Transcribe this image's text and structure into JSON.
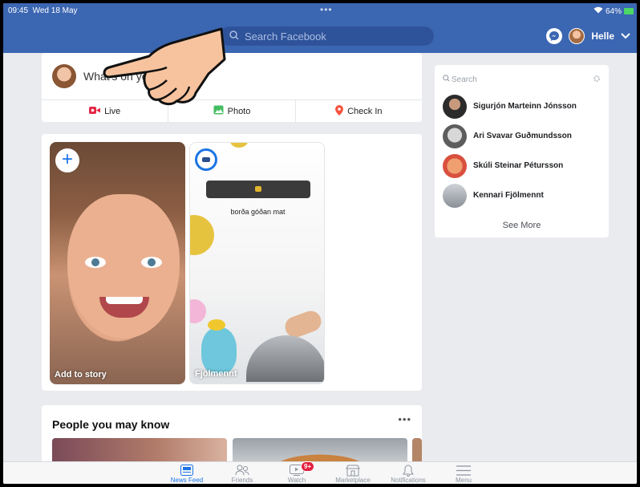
{
  "status": {
    "time": "09:45",
    "date": "Wed 18 May",
    "battery_percent": "64%",
    "battery_color": "#4cd964"
  },
  "header": {
    "search_placeholder": "Search Facebook",
    "user_name": "Helle",
    "brand_color": "#3b66b2"
  },
  "composer": {
    "placeholder": "What's on your mind?",
    "actions": [
      {
        "label": "Live",
        "icon": "live-video-icon",
        "color": "#e42645"
      },
      {
        "label": "Photo",
        "icon": "photo-icon",
        "color": "#45bd62"
      },
      {
        "label": "Check In",
        "icon": "location-pin-icon",
        "color": "#f5533d"
      }
    ]
  },
  "stories": [
    {
      "label": "Add to story"
    },
    {
      "label": "Fjölmennt",
      "caption": "borða góðan mat"
    }
  ],
  "pymk": {
    "title": "People you may know",
    "more": "•••"
  },
  "contacts": {
    "search_placeholder": "Search",
    "items": [
      {
        "name": "Sigurjón Marteinn Jónsson"
      },
      {
        "name": "Ari Svavar Guðmundsson"
      },
      {
        "name": "Skúli Steinar Pétursson"
      },
      {
        "name": "Kennari Fjölmennt"
      }
    ],
    "see_more": "See More"
  },
  "tabbar": {
    "tabs": [
      {
        "label": "News Feed",
        "icon": "news-feed-icon",
        "active": true
      },
      {
        "label": "Friends",
        "icon": "friends-icon"
      },
      {
        "label": "Watch",
        "icon": "watch-icon",
        "badge": "9+"
      },
      {
        "label": "Marketplace",
        "icon": "marketplace-icon"
      },
      {
        "label": "Notifications",
        "icon": "bell-icon"
      },
      {
        "label": "Menu",
        "icon": "menu-icon"
      }
    ],
    "active_color": "#1b74e4"
  }
}
